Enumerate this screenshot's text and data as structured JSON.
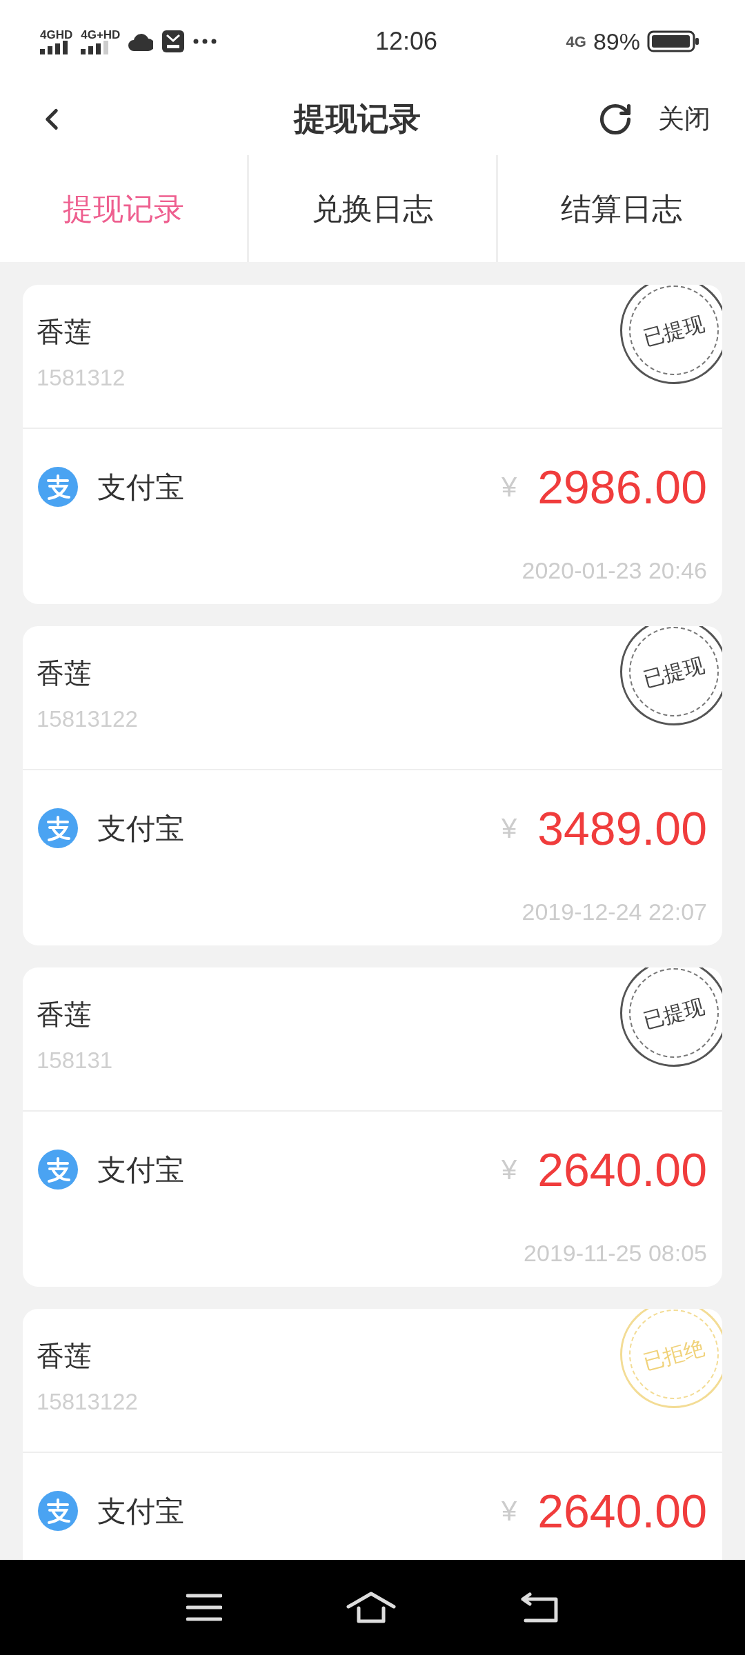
{
  "status_bar": {
    "signals": [
      "4GHD",
      "4G+HD"
    ],
    "time": "12:06",
    "network": "4G",
    "battery": "89%"
  },
  "header": {
    "title": "提现记录",
    "close": "关闭"
  },
  "tabs": [
    {
      "label": "提现记录",
      "selected": true
    },
    {
      "label": "兑换日志",
      "selected": false
    },
    {
      "label": "结算日志",
      "selected": false
    }
  ],
  "records": [
    {
      "name": "香莲",
      "phone": "1581312",
      "stamp": "已提现",
      "kind": "withdrawn",
      "method": "支付宝",
      "currency": "¥",
      "amount": "2986.00",
      "time": "2020-01-23 20:46"
    },
    {
      "name": "香莲",
      "phone": "15813122",
      "stamp": "已提现",
      "kind": "withdrawn",
      "method": "支付宝",
      "currency": "¥",
      "amount": "3489.00",
      "time": "2019-12-24 22:07"
    },
    {
      "name": "香莲",
      "phone": "158131",
      "stamp": "已提现",
      "kind": "withdrawn",
      "method": "支付宝",
      "currency": "¥",
      "amount": "2640.00",
      "time": "2019-11-25 08:05"
    },
    {
      "name": "香莲",
      "phone": "15813122",
      "stamp": "已拒绝",
      "kind": "rejected",
      "method": "支付宝",
      "currency": "¥",
      "amount": "2640.00"
    }
  ]
}
